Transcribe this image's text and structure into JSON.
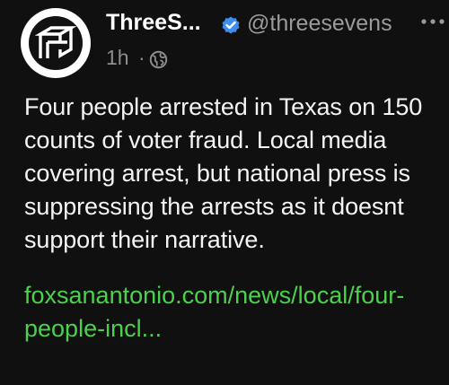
{
  "post": {
    "author": {
      "name": "ThreeS...",
      "handle": "@threesevens",
      "avatar_icon": "threesevens-cube-logo-icon",
      "verified_icon": "verified-badge-icon",
      "verified_color": "#3d8ef0"
    },
    "meta": {
      "time": "1h",
      "separator": "·",
      "visibility_icon": "globe-icon"
    },
    "more_icon": "more-options-icon",
    "text": "Four people arrested in Texas on 150 counts of voter fraud. Local media covering arrest, but national press is suppressing the arrests as it doesnt support their narrative.",
    "link": {
      "text": "foxsanantonio.com/news/local/four-people-incl...",
      "color": "#4bd14b"
    }
  }
}
